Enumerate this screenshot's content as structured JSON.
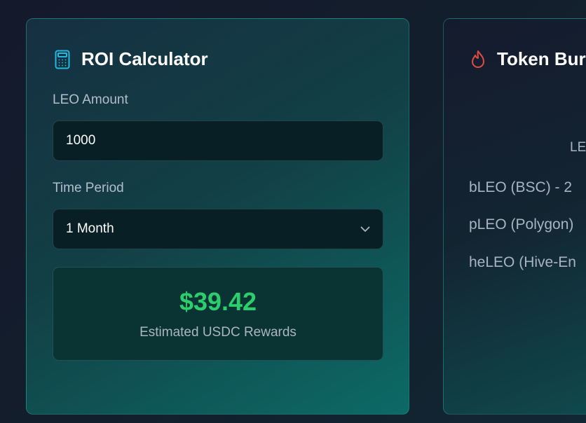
{
  "roi": {
    "title": "ROI Calculator",
    "icon": "calculator-icon",
    "amount_label": "LEO Amount",
    "amount_value": "1000",
    "period_label": "Time Period",
    "period_selected": "1 Month",
    "result_value": "$39.42",
    "result_caption": "Estimated USDC Rewards",
    "accent_color": "#2ccd6c"
  },
  "burn": {
    "title": "Token Bur",
    "icon": "flame-icon",
    "subheading": "LE",
    "items": [
      "bLEO (BSC) - 2",
      "pLEO (Polygon)",
      "heLEO (Hive-En"
    ],
    "accent_color": "#e24b3f"
  }
}
